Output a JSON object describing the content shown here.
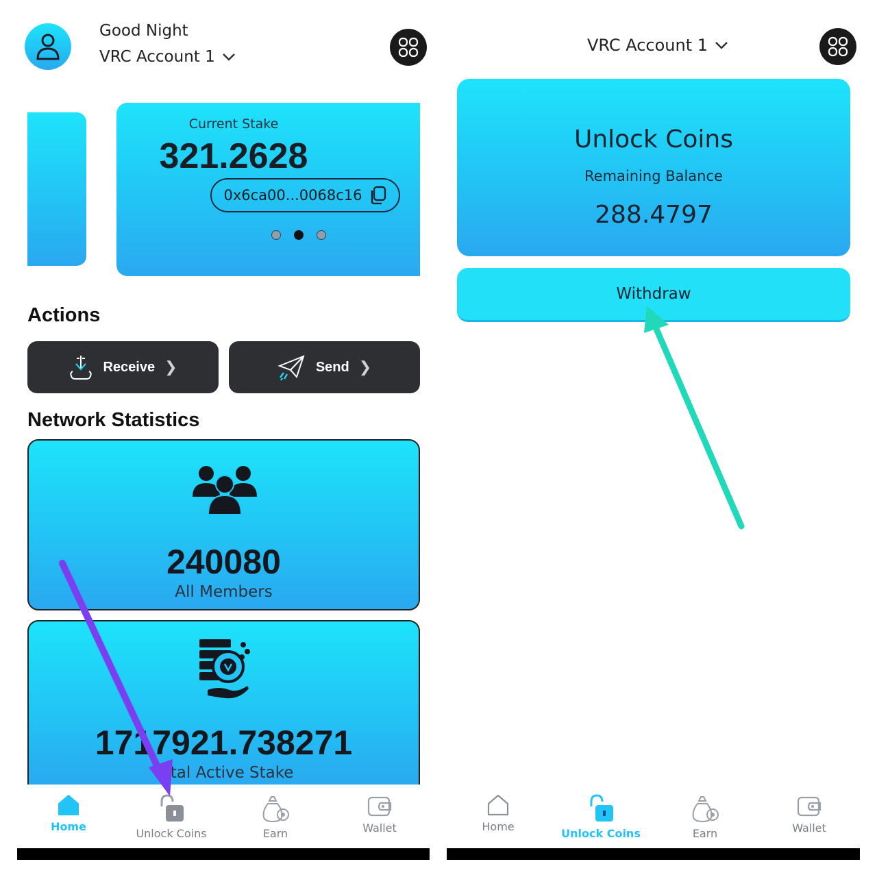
{
  "left": {
    "greeting": "Good Night",
    "account_name": "VRC Account 1",
    "stake_card": {
      "label": "Current Stake",
      "value": "321.2628",
      "address": "0x6ca00...0068c16",
      "page_count": 3,
      "active_page": 2
    },
    "actions_title": "Actions",
    "receive_label": "Receive",
    "send_label": "Send",
    "network_title": "Network Statistics",
    "members_value": "240080",
    "members_label": "All Members",
    "active_stake_value": "1717921.738271",
    "active_stake_label": "Total Active Stake"
  },
  "right": {
    "account_name": "VRC Account 1",
    "unlock_title": "Unlock Coins",
    "remaining_label": "Remaining Balance",
    "remaining_value": "288.4797",
    "withdraw_label": "Withdraw"
  },
  "nav": {
    "home": "Home",
    "unlock": "Unlock Coins",
    "earn": "Earn",
    "wallet": "Wallet"
  },
  "colors": {
    "accent": "#22c4f5",
    "card_top": "#1ee3fb",
    "card_bottom": "#2aa8f0",
    "dark_button": "#2e2f33",
    "arrow_left": "#7b3ff2",
    "arrow_right": "#21d8b8"
  },
  "icons": {
    "avatar": "user-icon",
    "menu": "grid-menu-icon",
    "dropdown": "chevron-down-icon",
    "copy": "copy-icon",
    "receive": "download-tray-icon",
    "send": "paper-plane-icon",
    "members": "group-icon",
    "stake": "coin-stack-hand-icon",
    "home": "home-icon",
    "unlock": "unlock-icon",
    "earn": "money-bag-icon",
    "wallet": "wallet-icon"
  }
}
